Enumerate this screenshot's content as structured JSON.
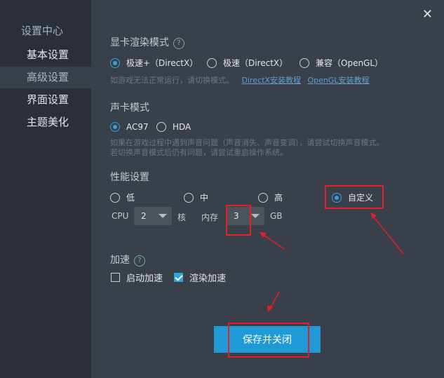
{
  "sidebar": {
    "title": "设置中心",
    "items": [
      {
        "label": "基本设置",
        "active": false
      },
      {
        "label": "高级设置",
        "active": true
      },
      {
        "label": "界面设置",
        "active": false
      },
      {
        "label": "主题美化",
        "active": false
      }
    ]
  },
  "close_label": "✕",
  "graphics": {
    "title": "显卡渲染模式",
    "options": [
      "极速+（DirectX）",
      "极速（DirectX）",
      "兼容（OpenGL）"
    ],
    "selected": "极速+（DirectX）",
    "hint": "如游戏无法正常运行，请切换模式。",
    "link1": "DirectX安装教程",
    "link2": "OpenGL安装教程"
  },
  "sound": {
    "title": "声卡模式",
    "options": [
      "AC97",
      "HDA"
    ],
    "selected": "AC97",
    "hint_line1": "如果在游戏过程中遇到声音问题（声音消失、声音变调），请尝试切换声音模式。",
    "hint_line2": "若切换声音模式后仍有问题，请尝试重启操作系统。"
  },
  "performance": {
    "title": "性能设置",
    "options": [
      "低",
      "中",
      "高",
      "自定义"
    ],
    "selected": "自定义",
    "cpu_label": "CPU",
    "cpu_value": "2",
    "cpu_unit": "核",
    "mem_label": "内存",
    "mem_value": "3",
    "mem_unit": "GB"
  },
  "accel": {
    "title": "加速",
    "items": [
      {
        "label": "启动加速",
        "checked": false
      },
      {
        "label": "渲染加速",
        "checked": true
      }
    ]
  },
  "save_button": "保存并关闭",
  "colors": {
    "accent": "#1f9ad6",
    "annotation": "#e0202a",
    "background": "#3a4049",
    "sidebar": "#2b3038"
  }
}
